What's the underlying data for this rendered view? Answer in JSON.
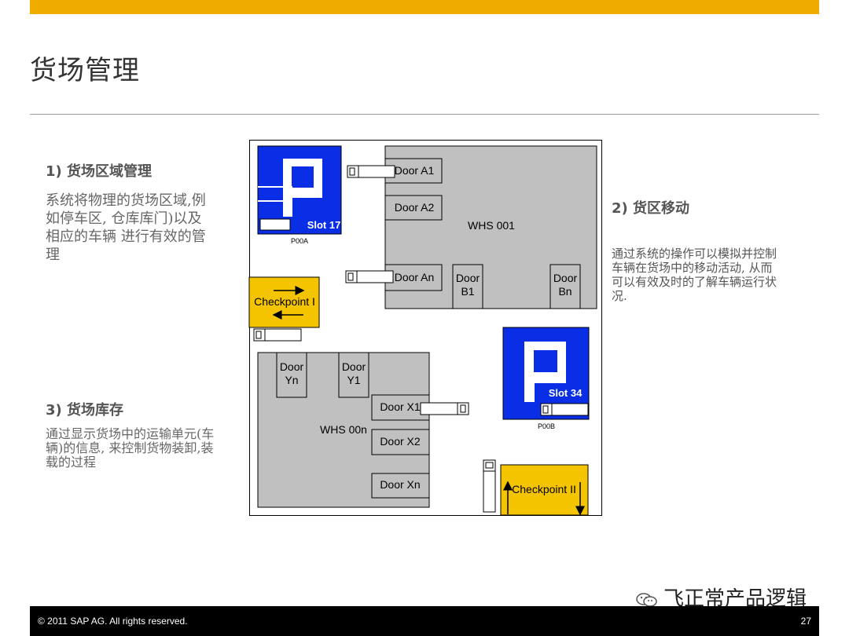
{
  "page": {
    "title": "货场管理",
    "page_number": "27"
  },
  "footer": {
    "copyright": "©  2011 SAP AG. All rights reserved."
  },
  "sections": {
    "s1": {
      "heading": "1) 货场区域管理",
      "body": [
        "系统将物理的货场区域,例",
        "如停车区, 仓库库门)以及",
        "相应的车辆 进行有效的管",
        "理"
      ]
    },
    "s2": {
      "heading": "2) 货区移动",
      "body": [
        "通过系统的操作可以模拟并控制",
        "车辆在货场中的移动活动, 从而",
        "可以有效及时的了解车辆运行状",
        "况."
      ]
    },
    "s3": {
      "heading": "3) 货场库存",
      "body": [
        "通过显示货场中的运输单元(车",
        "辆)的信息, 来控制货物装卸,装",
        "载的过程"
      ]
    }
  },
  "diagram": {
    "parking1": {
      "slot": "Slot 17",
      "code": "P00A"
    },
    "parking2": {
      "slot": "Slot 34",
      "code": "P00B"
    },
    "checkpoint1": "Checkpoint I",
    "checkpoint2": "Checkpoint II",
    "whs1": {
      "label": "WHS 001",
      "doors": [
        "Door A1",
        "Door A2",
        "Door An"
      ],
      "door_b1": [
        "Door",
        "B1"
      ],
      "door_bn": [
        "Door",
        "Bn"
      ]
    },
    "whs2": {
      "label": "WHS 00n",
      "doors": [
        "Door X1",
        "Door X2",
        "Door Xn"
      ],
      "door_yn": [
        "Door",
        "Yn"
      ],
      "door_y1": [
        "Door",
        "Y1"
      ]
    },
    "colors": {
      "parking_blue": "#0a2ee6",
      "checkpoint_yellow": "#f5c400",
      "warehouse_gray": "#c0c0c0",
      "brand_orange": "#f0ab00"
    }
  },
  "watermark": "飞正常产品逻辑"
}
